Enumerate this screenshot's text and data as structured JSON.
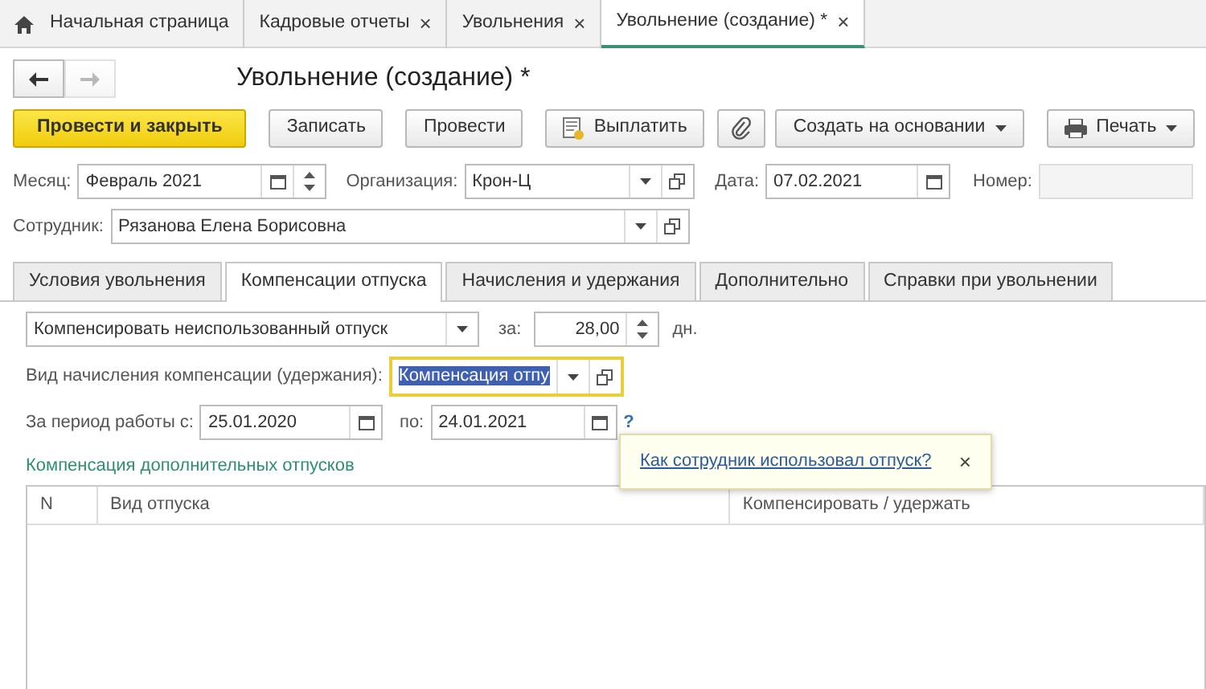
{
  "tabs": [
    {
      "label": "Начальная страница",
      "kind": "home",
      "selected": false
    },
    {
      "label": "Кадровые отчеты",
      "kind": "closable",
      "close": "×",
      "selected": false
    },
    {
      "label": "Увольнения",
      "kind": "closable",
      "close": "×",
      "selected": false
    },
    {
      "label": "Увольнение (создание) *",
      "kind": "closable",
      "close": "×",
      "selected": true
    }
  ],
  "nav_buttons": [
    {
      "kind": "back",
      "disabled": false
    },
    {
      "kind": "forward",
      "disabled": true
    }
  ],
  "title": "Увольнение (создание) *",
  "toolbar": [
    {
      "label": "Провести и закрыть",
      "kind": "primary"
    },
    {
      "label": "Записать",
      "kind": "plain"
    },
    {
      "label": "Провести",
      "kind": "plain"
    },
    {
      "label": "Выплатить",
      "kind": "document"
    },
    {
      "kind": "clip"
    },
    {
      "label": "Создать на основании",
      "kind": "dropdown"
    },
    {
      "label": "Печать",
      "kind": "print"
    }
  ],
  "header_rows": [
    [
      {
        "label": "Месяц:",
        "value": "Февраль 2021",
        "kind": "month"
      },
      {
        "label": "Организация:",
        "value": "Крон-Ц",
        "kind": "org"
      },
      {
        "label": "Дата:",
        "value": "07.02.2021",
        "kind": "date"
      },
      {
        "label": "Номер:",
        "kind": "number",
        "disabled": true
      }
    ],
    [
      {
        "label": "Сотрудник:",
        "value": "Рязанова Елена Борисовна",
        "kind": "employee"
      }
    ]
  ],
  "doc_tabs": [
    {
      "label": "Условия увольнения",
      "selected": false
    },
    {
      "label": "Компенсации отпуска",
      "selected": true
    },
    {
      "label": "Начисления и удержания",
      "selected": false
    },
    {
      "label": "Дополнительно",
      "selected": false
    },
    {
      "label": "Справки при увольнении",
      "selected": false
    }
  ],
  "compensation": {
    "mode": "Компенсировать неиспользованный отпуск",
    "days_label": "за:",
    "days": "28,00",
    "days_unit": "дн.",
    "kind_label": "Вид начисления компенсации (удержания):",
    "kind_value": "Компенсация отпу",
    "kind_focused": true,
    "kind_highlighted": true,
    "from_label": "За период работы с:",
    "from": "25.01.2020",
    "to_label": "по:",
    "to": "24.01.2021",
    "help": "?"
  },
  "section_title": "Компенсация дополнительных отпусков",
  "popup": {
    "link": "Как сотрудник использовал отпуск?",
    "close": "×"
  },
  "table": {
    "columns": [
      "N",
      "Вид отпуска",
      "Компенсировать / удержать"
    ]
  }
}
